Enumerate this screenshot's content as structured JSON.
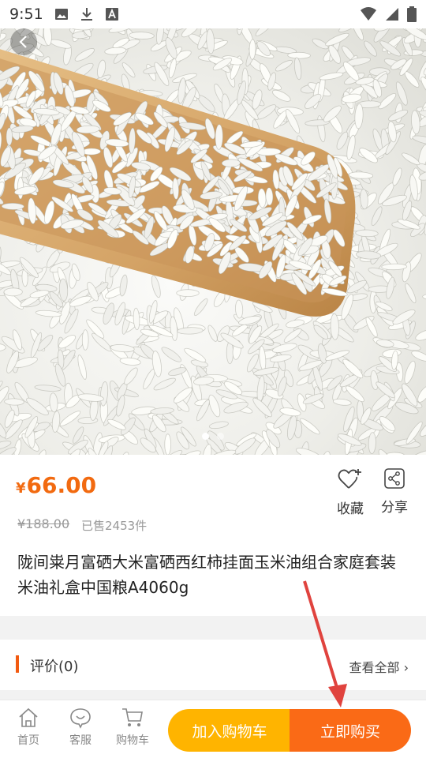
{
  "status_bar": {
    "time": "9:51",
    "left_icons": [
      "image-icon",
      "download-icon",
      "font-icon"
    ],
    "right_icons": [
      "wifi-icon",
      "signal-icon",
      "battery-icon"
    ]
  },
  "gallery": {
    "image_description_icon": "rice-scoop-image",
    "slide_count": 2,
    "active_slide": 1
  },
  "product": {
    "currency": "¥",
    "price": "66.00",
    "original_price": "¥188.00",
    "sold": "已售2453件",
    "title": "陇间粜月富硒大米富硒西红柿挂面玉米油组合家庭套装米油礼盒中国粮A4060g"
  },
  "actions": {
    "favorite_label": "收藏",
    "share_label": "分享"
  },
  "review": {
    "label": "评价(0)",
    "view_all": "查看全部 ›"
  },
  "bottom_nav": {
    "home": "首页",
    "service": "客服",
    "cart": "购物车",
    "add_to_cart": "加入购物车",
    "buy_now": "立即购买"
  },
  "colors": {
    "accent": "#f26a10",
    "cart_button": "#ffb400",
    "buy_button": "#fa6a16",
    "annotation_arrow": "#e0433e"
  }
}
